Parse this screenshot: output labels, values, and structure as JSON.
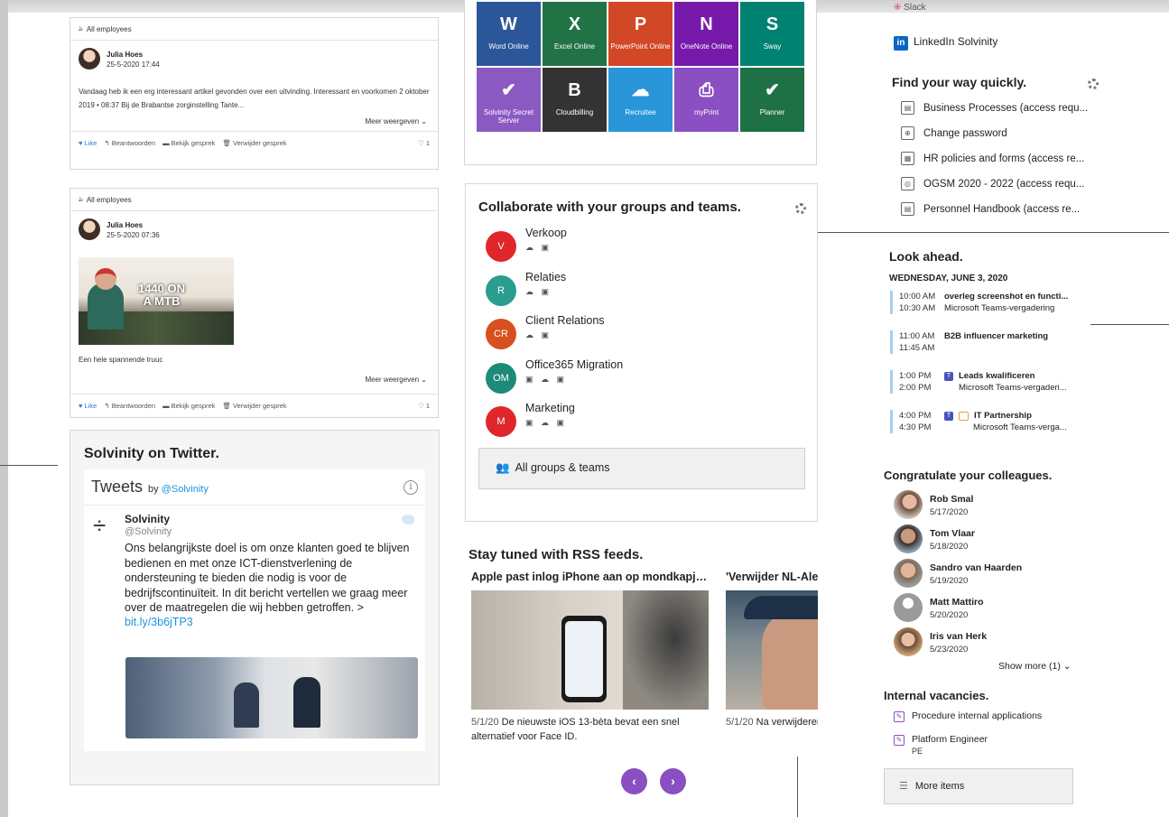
{
  "yammer": {
    "posts": [
      {
        "group": "All employees",
        "author": "Julia Hoes",
        "date": "25-5-2020  17:44",
        "text": "Vandaag heb ik een erg interessant artikel gevonden over een uitvinding. Interessant en voorkomen 2 oktober 2019 • 08:37 Bij de Brabantse zorginstelling Tante...",
        "more": "Meer weergeven",
        "like": "Like",
        "reply": "Beantwoorden",
        "view": "Bekijk gesprek",
        "delete": "Verwijder gesprek",
        "count": "1"
      },
      {
        "group": "All employees",
        "author": "Julia Hoes",
        "date": "25-5-2020  07:36",
        "image_text": "1440 ON A MTB",
        "text": "Een hele spannende truuc",
        "more": "Meer weergeven",
        "like": "Like",
        "reply": "Beantwoorden",
        "view": "Bekijk gesprek",
        "delete": "Verwijder gesprek",
        "count": "1"
      }
    ]
  },
  "twitter": {
    "title": "Solvinity on Twitter.",
    "widget_title": "Tweets",
    "by": "by",
    "handle_link": "@Solvinity",
    "tweet": {
      "name": "Solvinity",
      "handle": "@Solvinity",
      "text": "Ons belangrijkste doel is om onze klanten goed te blijven bedienen en met onze ICT-dienstverlening de ondersteuning te bieden die nodig is voor de bedrijfscontinuïteit. In dit bericht vertellen we graag meer over de maatregelen die wij hebben getroffen. >",
      "link": "bit.ly/3b6jTP3"
    }
  },
  "apps": [
    {
      "label": "Word Online",
      "icon": "W",
      "color": "#2b579a"
    },
    {
      "label": "Excel Online",
      "icon": "X",
      "color": "#217346"
    },
    {
      "label": "PowerPoint Online",
      "icon": "P",
      "color": "#d24726"
    },
    {
      "label": "OneNote Online",
      "icon": "N",
      "color": "#7719aa"
    },
    {
      "label": "Sway",
      "icon": "S",
      "color": "#008272"
    },
    {
      "label": "Solvinity Secret Server",
      "icon": "✔",
      "color": "#8a5ac2"
    },
    {
      "label": "Cloudbilling",
      "icon": "B",
      "color": "#333333"
    },
    {
      "label": "Recruitee",
      "icon": "☁",
      "color": "#2996d9"
    },
    {
      "label": "myPrint",
      "icon": "⎙",
      "color": "#8a4fc2"
    },
    {
      "label": "Planner",
      "icon": "✔",
      "color": "#1e7145"
    }
  ],
  "collab": {
    "title": "Collaborate with your groups and teams.",
    "groups": [
      {
        "initials": "V",
        "name": "Verkoop",
        "color": "#e0262b",
        "icons": "☁ ▣"
      },
      {
        "initials": "R",
        "name": "Relaties",
        "color": "#2a9d8f",
        "icons": "☁ ▣"
      },
      {
        "initials": "CR",
        "name": "Client Relations",
        "color": "#d8501e",
        "icons": "☁ ▣"
      },
      {
        "initials": "OM",
        "name": "Office365 Migration",
        "color": "#1e8a7a",
        "icons": "▣ ☁ ▣"
      },
      {
        "initials": "M",
        "name": "Marketing",
        "color": "#e0262b",
        "icons": "▣ ☁ ▣"
      }
    ],
    "all_groups": "All groups & teams"
  },
  "rss": {
    "title": "Stay tuned with RSS feeds.",
    "items": [
      {
        "title": "Apple past inlog iPhone aan op mondkapjes",
        "date": "5/1/20",
        "desc": "De nieuwste iOS 13-bèta bevat een snel alternatief voor Face ID."
      },
      {
        "title": "'Verwijder NL-Alert'",
        "date": "5/1/20",
        "desc": "Na verwijderen door."
      }
    ]
  },
  "right": {
    "slack": "Slack",
    "linkedin": "LinkedIn Solvinity",
    "quick_title": "Find your way quickly.",
    "quick_links": [
      "Business Processes (access requ...",
      "Change password",
      "HR policies and forms (access re...",
      "OGSM 2020 - 2022 (access requ...",
      "Personnel Handbook (access re..."
    ],
    "look_title": "Look ahead.",
    "day": "WEDNESDAY, JUNE 3, 2020",
    "events": [
      {
        "start": "10:00 AM",
        "end": "10:30 AM",
        "title": "overleg screenshot en functi...",
        "sub": "Microsoft Teams-vergadering"
      },
      {
        "start": "11:00 AM",
        "end": "11:45 AM",
        "title": "B2B influencer marketing",
        "sub": ""
      },
      {
        "start": "1:00 PM",
        "end": "2:00 PM",
        "title": "Leads kwalificeren",
        "sub": "Microsoft Teams-vergaderi..."
      },
      {
        "start": "4:00 PM",
        "end": "4:30 PM",
        "title": "IT Partnership",
        "sub": "Microsoft Teams-verga..."
      }
    ],
    "congrats_title": "Congratulate your colleagues.",
    "colleagues": [
      {
        "name": "Rob Smal",
        "date": "5/17/2020"
      },
      {
        "name": "Tom Vlaar",
        "date": "5/18/2020"
      },
      {
        "name": "Sandro van Haarden",
        "date": "5/19/2020"
      },
      {
        "name": "Matt Mattiro",
        "date": "5/20/2020"
      },
      {
        "name": "Iris van Herk",
        "date": "5/23/2020"
      }
    ],
    "show_more": "Show more (1)",
    "vac_title": "Internal vacancies.",
    "vacancies": [
      {
        "title": "Procedure internal applications",
        "sub": ""
      },
      {
        "title": "Platform Engineer",
        "sub": "PE"
      }
    ],
    "more_items": "More items"
  }
}
